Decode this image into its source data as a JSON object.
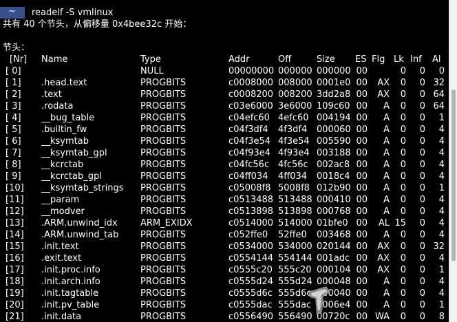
{
  "prompt": {
    "symbol": "~",
    "command": "readelf -S vmlinux"
  },
  "summary": "共有 40 个节头，从偏移量 0x4bee32c 开始：",
  "section_label": "节头：",
  "headers": {
    "nr": "[Nr]",
    "name": "Name",
    "type": "Type",
    "addr": "Addr",
    "off": "Off",
    "size": "Size",
    "es": "ES",
    "flg": "Flg",
    "lk": "Lk",
    "inf": "Inf",
    "al": "Al"
  },
  "rows": [
    {
      "nr": "[ 0]",
      "name": "",
      "type": "NULL",
      "addr": "00000000",
      "off": "000000",
      "size": "000000",
      "es": "00",
      "flg": "",
      "lk": "0",
      "inf": "0",
      "al": "0"
    },
    {
      "nr": "[ 1]",
      "name": ".head.text",
      "type": "PROGBITS",
      "addr": "c0008000",
      "off": "008000",
      "size": "0001e0",
      "es": "00",
      "flg": "AX",
      "lk": "0",
      "inf": "0",
      "al": "32"
    },
    {
      "nr": "[ 2]",
      "name": ".text",
      "type": "PROGBITS",
      "addr": "c0008200",
      "off": "008200",
      "size": "3dd2a8",
      "es": "00",
      "flg": "AX",
      "lk": "0",
      "inf": "0",
      "al": "64"
    },
    {
      "nr": "[ 3]",
      "name": ".rodata",
      "type": "PROGBITS",
      "addr": "c03e6000",
      "off": "3e6000",
      "size": "109c60",
      "es": "00",
      "flg": "A",
      "lk": "0",
      "inf": "0",
      "al": "64"
    },
    {
      "nr": "[ 4]",
      "name": "__bug_table",
      "type": "PROGBITS",
      "addr": "c04efc60",
      "off": "4efc60",
      "size": "004194",
      "es": "00",
      "flg": "A",
      "lk": "0",
      "inf": "0",
      "al": "1"
    },
    {
      "nr": "[ 5]",
      "name": ".builtin_fw",
      "type": "PROGBITS",
      "addr": "c04f3df4",
      "off": "4f3df4",
      "size": "000060",
      "es": "00",
      "flg": "A",
      "lk": "0",
      "inf": "0",
      "al": "4"
    },
    {
      "nr": "[ 6]",
      "name": "__ksymtab",
      "type": "PROGBITS",
      "addr": "c04f3e54",
      "off": "4f3e54",
      "size": "005590",
      "es": "00",
      "flg": "A",
      "lk": "0",
      "inf": "0",
      "al": "4"
    },
    {
      "nr": "[ 7]",
      "name": "__ksymtab_gpl",
      "type": "PROGBITS",
      "addr": "c04f93e4",
      "off": "4f93e4",
      "size": "003188",
      "es": "00",
      "flg": "A",
      "lk": "0",
      "inf": "0",
      "al": "4"
    },
    {
      "nr": "[ 8]",
      "name": "__kcrctab",
      "type": "PROGBITS",
      "addr": "c04fc56c",
      "off": "4fc56c",
      "size": "002ac8",
      "es": "00",
      "flg": "A",
      "lk": "0",
      "inf": "0",
      "al": "4"
    },
    {
      "nr": "[ 9]",
      "name": "__kcrctab_gpl",
      "type": "PROGBITS",
      "addr": "c04ff034",
      "off": "4ff034",
      "size": "0018c4",
      "es": "00",
      "flg": "A",
      "lk": "0",
      "inf": "0",
      "al": "4"
    },
    {
      "nr": "[10]",
      "name": "__ksymtab_strings",
      "type": "PROGBITS",
      "addr": "c05008f8",
      "off": "5008f8",
      "size": "012b90",
      "es": "00",
      "flg": "A",
      "lk": "0",
      "inf": "0",
      "al": "1"
    },
    {
      "nr": "[11]",
      "name": "__param",
      "type": "PROGBITS",
      "addr": "c0513488",
      "off": "513488",
      "size": "000410",
      "es": "00",
      "flg": "A",
      "lk": "0",
      "inf": "0",
      "al": "4"
    },
    {
      "nr": "[12]",
      "name": "__modver",
      "type": "PROGBITS",
      "addr": "c0513898",
      "off": "513898",
      "size": "000768",
      "es": "00",
      "flg": "A",
      "lk": "0",
      "inf": "0",
      "al": "4"
    },
    {
      "nr": "[13]",
      "name": ".ARM.unwind_idx",
      "type": "ARM_EXIDX",
      "addr": "c0514000",
      "off": "514000",
      "size": "01bfe0",
      "es": "00",
      "flg": "AL",
      "lk": "15",
      "inf": "0",
      "al": "4"
    },
    {
      "nr": "[14]",
      "name": ".ARM.unwind_tab",
      "type": "PROGBITS",
      "addr": "c052ffe0",
      "off": "52ffe0",
      "size": "003468",
      "es": "00",
      "flg": "A",
      "lk": "0",
      "inf": "0",
      "al": "4"
    },
    {
      "nr": "[15]",
      "name": ".init.text",
      "type": "PROGBITS",
      "addr": "c0534000",
      "off": "534000",
      "size": "020144",
      "es": "00",
      "flg": "AX",
      "lk": "0",
      "inf": "0",
      "al": "32"
    },
    {
      "nr": "[16]",
      "name": ".exit.text",
      "type": "PROGBITS",
      "addr": "c0554144",
      "off": "554144",
      "size": "001adc",
      "es": "00",
      "flg": "AX",
      "lk": "0",
      "inf": "0",
      "al": "4"
    },
    {
      "nr": "[17]",
      "name": ".init.proc.info",
      "type": "PROGBITS",
      "addr": "c0555c20",
      "off": "555c20",
      "size": "000104",
      "es": "00",
      "flg": "AX",
      "lk": "0",
      "inf": "0",
      "al": "1"
    },
    {
      "nr": "[18]",
      "name": ".init.arch.info",
      "type": "PROGBITS",
      "addr": "c0555d24",
      "off": "555d24",
      "size": "000048",
      "es": "00",
      "flg": "A",
      "lk": "0",
      "inf": "0",
      "al": "4"
    },
    {
      "nr": "[19]",
      "name": ".init.tagtable",
      "type": "PROGBITS",
      "addr": "c0555d6c",
      "off": "555d6c",
      "size": "000040",
      "es": "00",
      "flg": "A",
      "lk": "0",
      "inf": "0",
      "al": "4"
    },
    {
      "nr": "[20]",
      "name": ".init.pv_table",
      "type": "PROGBITS",
      "addr": "c0555dac",
      "off": "555dac",
      "size": "0006e4",
      "es": "00",
      "flg": "A",
      "lk": "0",
      "inf": "0",
      "al": "1"
    },
    {
      "nr": "[21]",
      "name": ".init.data",
      "type": "PROGBITS",
      "addr": "c0556490",
      "off": "556490",
      "size": "00720c",
      "es": "00",
      "flg": "WA",
      "lk": "0",
      "inf": "0",
      "al": "8"
    }
  ],
  "colors": {
    "background": "#000000",
    "text": "#ffffff",
    "prompt_bg": "#3a4f8c",
    "scrollbar": "#f2f2f2"
  },
  "icons": {
    "cursor": "mouse-pointer-icon"
  }
}
